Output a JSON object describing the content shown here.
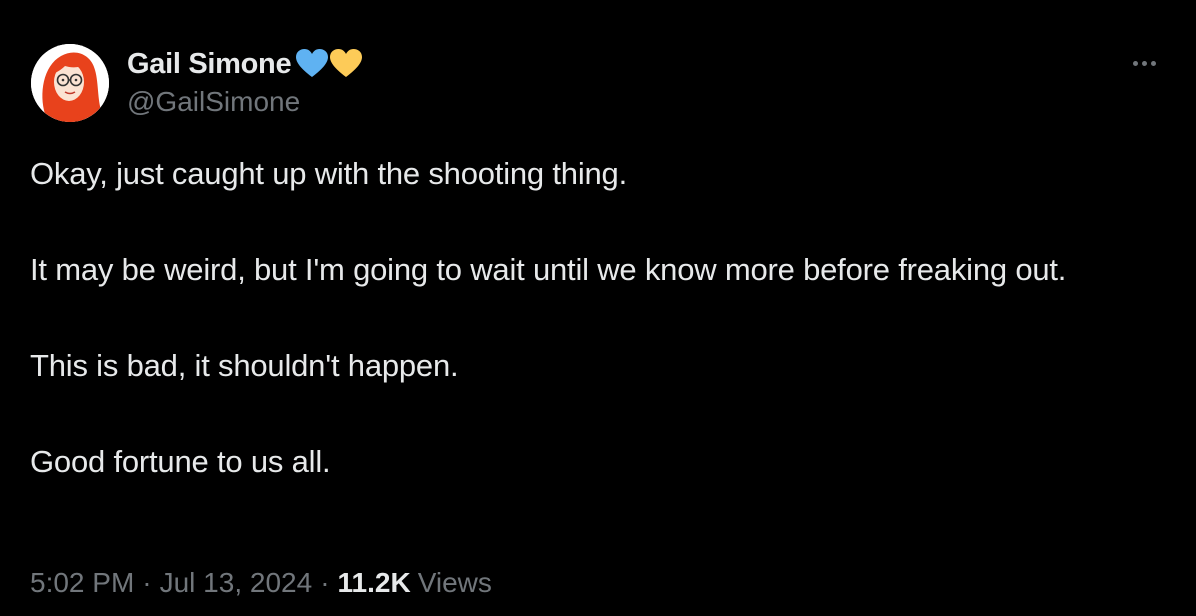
{
  "author": {
    "name": "Gail Simone",
    "handle": "@GailSimone",
    "avatar_icon": "avatar-redhead-glasses",
    "emoji": [
      {
        "name": "blue-heart-icon",
        "color": "#5fb2f2"
      },
      {
        "name": "yellow-heart-icon",
        "color": "#fdcb58"
      }
    ]
  },
  "more_label": "···",
  "tweet": {
    "paragraphs": [
      "Okay, just caught up with the shooting thing.",
      "It may be weird, but I'm going to wait until we know more before freaking out.",
      "This is bad, it shouldn't happen.",
      "Good fortune to us all."
    ]
  },
  "meta": {
    "time": "5:02 PM",
    "separator": "·",
    "date": "Jul 13, 2024",
    "views_count": "11.2K",
    "views_label": "Views"
  },
  "colors": {
    "background": "#000000",
    "text_primary": "#e7e9ea",
    "text_secondary": "#71767b",
    "avatar_hair": "#e8421c"
  }
}
